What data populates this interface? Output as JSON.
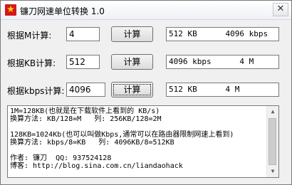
{
  "window": {
    "title": "镰刀网速单位转换 1.0",
    "app_icon": "star-icon",
    "close_glyph": "✕"
  },
  "rows": [
    {
      "label": "根据M计算:",
      "input_value": "4",
      "button_label": "计算",
      "result": "512 KB      4096 kbps"
    },
    {
      "label": "根据KB计算:",
      "input_value": "512",
      "button_label": "计算",
      "result": "4096 kbps      4 M"
    },
    {
      "label": "根据kbps计算:",
      "input_value": "4096",
      "button_label": "计算",
      "result": "512 KB      4 M"
    }
  ],
  "notes": {
    "lines": [
      "1M=128KB(也就是在下载软件上看到的 KB/s)",
      "换算方法: KB/128=M   列: 256KB/128=2M",
      "",
      "128KB=1024Kb(也可以叫做Kbps,通常可以在路由器限制网速上看到)",
      "换算方法: kbps/8=KB   列: 4096KB/8=512KB",
      "",
      "作者: 镰刀  QQ: 937524128",
      "博客: http://blog.sina.com.cn/liandaohack"
    ]
  }
}
